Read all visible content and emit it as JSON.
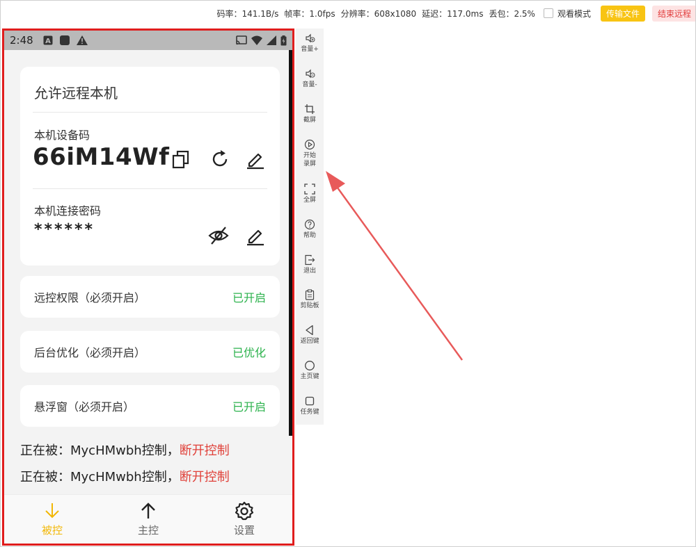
{
  "topbar": {
    "bitrate": "码率：141.1B/s",
    "framerate": "帧率：1.0fps",
    "resolution": "分辨率：608x1080",
    "latency": "延迟：117.0ms",
    "packet_loss": "丢包：2.5%",
    "watch_mode_label": "观看模式",
    "transfer_files_label": "传输文件",
    "end_remote_label": "结束远程"
  },
  "phone": {
    "status": {
      "time": "2:48",
      "icons_left": [
        "a-icon",
        "square-icon",
        "warning-icon"
      ],
      "icons_right": [
        "cast-icon",
        "wifi-icon",
        "signal-icon",
        "battery-icon"
      ]
    },
    "card": {
      "title": "允许远程本机",
      "device_code_label": "本机设备码",
      "device_code": "66iM14Wf",
      "password_label": "本机连接密码",
      "password": "******"
    },
    "rows": [
      {
        "label": "远控权限（必须开启）",
        "status": "已开启"
      },
      {
        "label": "后台优化（必须开启）",
        "status": "已优化"
      },
      {
        "label": "悬浮窗（必须开启）",
        "status": "已开启"
      }
    ],
    "controls": [
      {
        "prefix": "正在被：MycHMwbh控制，",
        "action": "断开控制"
      },
      {
        "prefix": "正在被：MycHMwbh控制，",
        "action": "断开控制"
      }
    ],
    "nav": [
      {
        "label": "被控",
        "active": true
      },
      {
        "label": "主控",
        "active": false
      },
      {
        "label": "设置",
        "active": false
      }
    ]
  },
  "toolbar": {
    "items": [
      {
        "label": "音量+",
        "icon": "volume-up-icon"
      },
      {
        "label": "音量-",
        "icon": "volume-down-icon"
      },
      {
        "label": "截屏",
        "icon": "crop-icon"
      },
      {
        "label": "开始\n录屏",
        "icon": "record-icon"
      },
      {
        "label": "全屏",
        "icon": "fullscreen-icon"
      },
      {
        "label": "帮助",
        "icon": "help-icon"
      },
      {
        "label": "退出",
        "icon": "exit-icon"
      },
      {
        "label": "剪贴板",
        "icon": "clipboard-icon"
      },
      {
        "label": "返回键",
        "icon": "back-icon"
      },
      {
        "label": "主页键",
        "icon": "home-icon"
      },
      {
        "label": "任务键",
        "icon": "task-icon"
      }
    ]
  },
  "colors": {
    "accent": "#f2b705",
    "success": "#2bb24c",
    "danger": "#e0413a",
    "frame": "#e01d1d",
    "annotation_arrow": "#e85a5a"
  }
}
